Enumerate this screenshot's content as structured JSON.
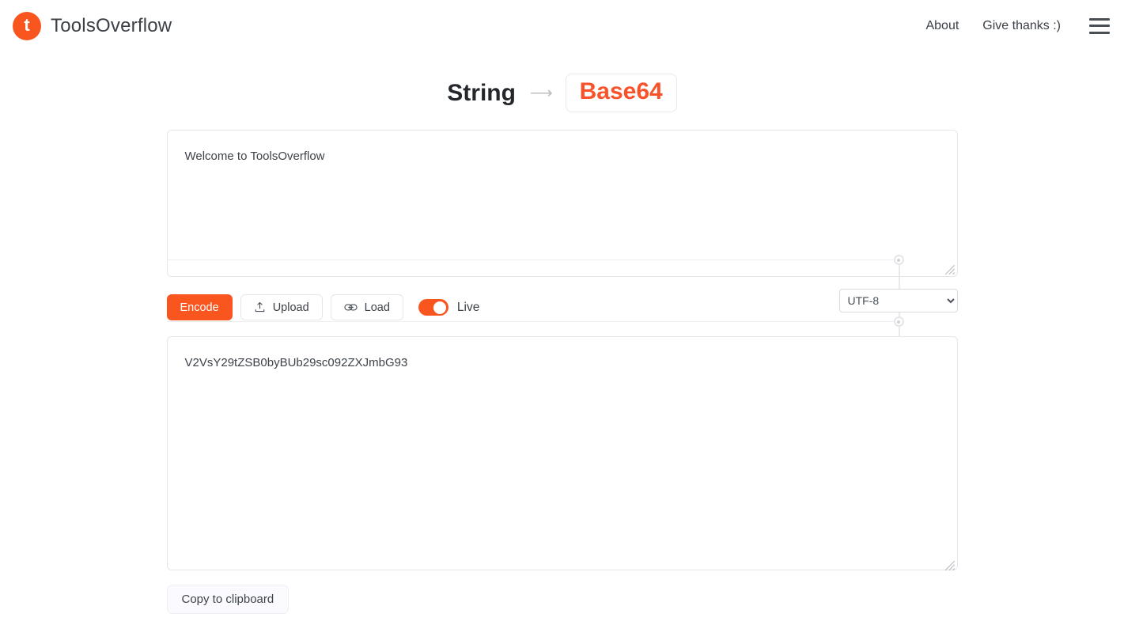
{
  "header": {
    "logo_letter": "t",
    "brand": "ToolsOverflow",
    "nav": [
      {
        "label": "About",
        "name": "nav-link-about"
      },
      {
        "label": "Give thanks :)",
        "name": "nav-link-give-thanks"
      }
    ],
    "menu_icon": "hamburger-menu-icon"
  },
  "title": {
    "from": "String",
    "arrow": "⟶",
    "to": "Base64"
  },
  "input": {
    "value": "Welcome to ToolsOverflow",
    "placeholder": ""
  },
  "controls": {
    "encode_label": "Encode",
    "upload_label": "Upload",
    "upload_icon": "upload-icon",
    "load_label": "Load",
    "load_icon": "link-icon",
    "live_label": "Live",
    "live_on": true
  },
  "encoding": {
    "selected": "UTF-8",
    "options": [
      "UTF-8"
    ]
  },
  "output": {
    "value": "V2VsY29tZSB0byBUb29sc092ZXJmbG93",
    "placeholder": ""
  },
  "footer": {
    "copy_label": "Copy to clipboard"
  },
  "colors": {
    "accent": "#f9551f",
    "accent_text": "#f9522a",
    "text": "#3d4349",
    "border": "#e4e6ea"
  }
}
